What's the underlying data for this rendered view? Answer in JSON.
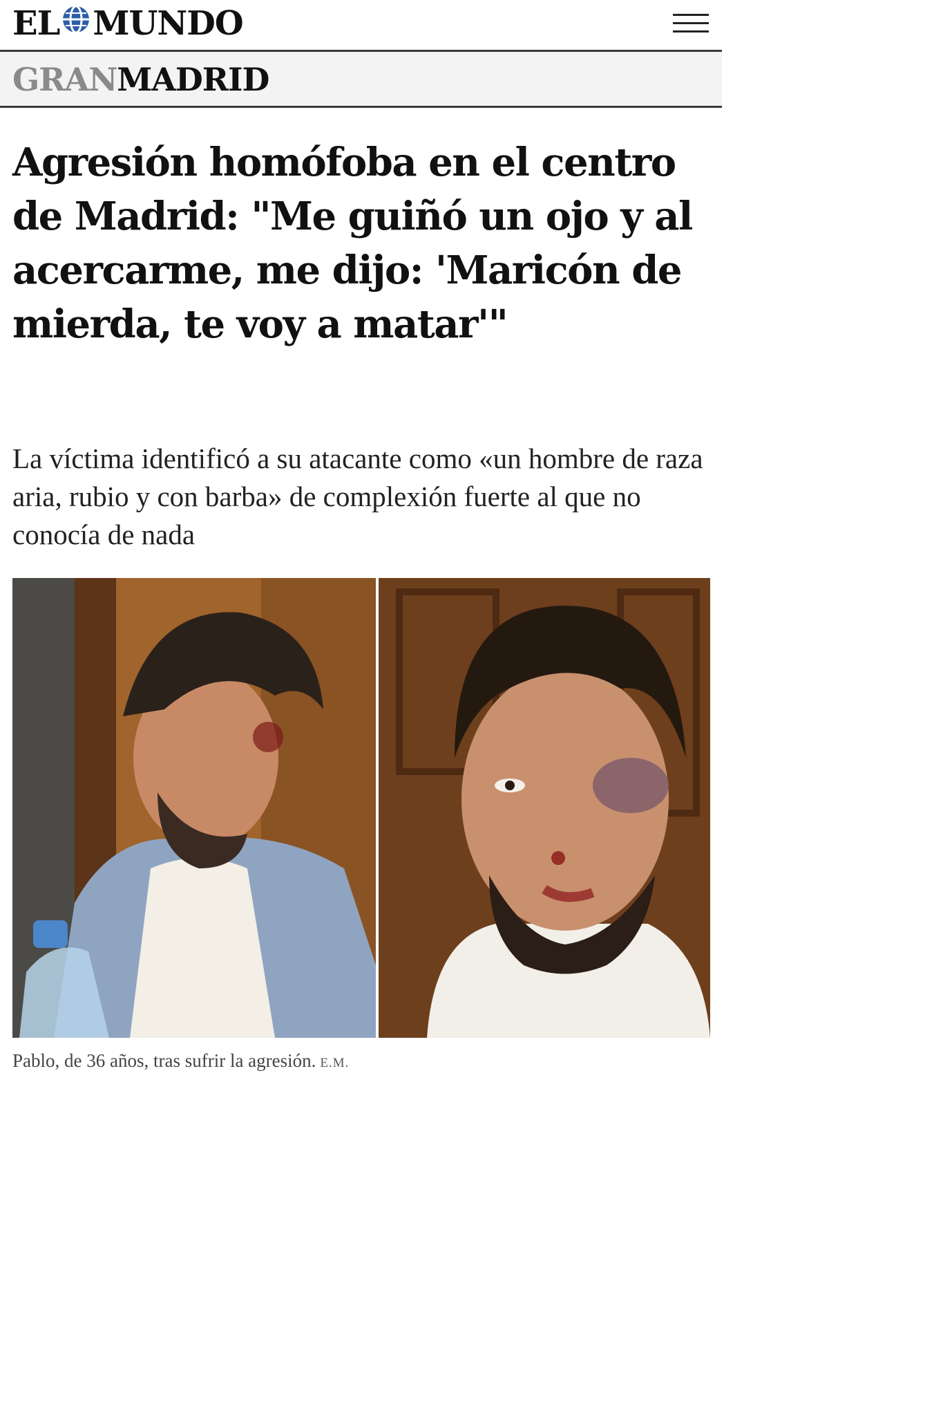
{
  "header": {
    "logo_left": "EL",
    "logo_right": "MUNDO",
    "menu_icon": "hamburger-menu-icon"
  },
  "section": {
    "gran": "GRAN",
    "madrid": "MADRID"
  },
  "article": {
    "headline": "Agresión homófoba en el centro de Madrid: \"Me guiñó un ojo y al acercarme, me dijo: 'Maricón de mierda, te voy a matar'\"",
    "standfirst": "La víctima identificó a su atacante como «un hombre de raza aria, rubio y con barba» de complexión fuerte al que no conocía de nada",
    "caption": "Pablo, de 36 años, tras sufrir la agresión.",
    "credit": "E.M."
  },
  "colors": {
    "brand": "#111111",
    "section_gray": "#8a8a8a",
    "rule": "#3a3a3a"
  }
}
